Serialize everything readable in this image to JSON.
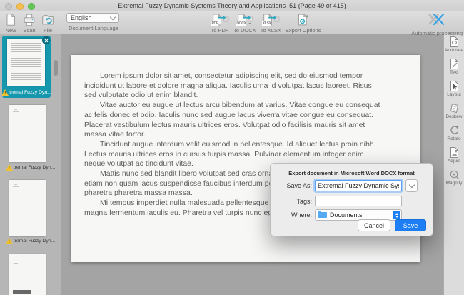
{
  "window": {
    "title": "Extremal Fuzzy Dynamic Systems Theory and Applications_51 (Page 49 of 415)"
  },
  "colors": {
    "accent_teal": "#1598ad",
    "macos_blue": "#1d7ff3",
    "icon_cyan": "#2aa9c0",
    "warning_yellow": "#f2c12e",
    "folder_blue": "#55a9f2"
  },
  "toolbar": {
    "buttons": [
      {
        "label": "New"
      },
      {
        "label": "Scan"
      },
      {
        "label": "File"
      }
    ],
    "language": {
      "value": "English",
      "label": "Document Language"
    },
    "export": [
      {
        "label": "To PDF",
        "badge": "PDF"
      },
      {
        "label": "To DOCX",
        "badge": "DOCX"
      },
      {
        "label": "To XLSX",
        "badge": "XLSX"
      },
      {
        "label": "Export Options"
      }
    ],
    "auto_label": "Automatic processing"
  },
  "sidebar": {
    "thumbnails": [
      {
        "label": "tremal Fuzzy Dyn...",
        "selected": true,
        "warning": true
      },
      {
        "label": "tremal Fuzzy Dyn...",
        "selected": false,
        "warning": true
      },
      {
        "label": "tremal Fuzzy Dyn...",
        "selected": false,
        "warning": true
      },
      {
        "label": "",
        "selected": false,
        "warning": false
      }
    ]
  },
  "document": {
    "paragraphs": [
      {
        "lines": [
          "Lorem ipsum dolor sit amet, consectetur adipiscing elit, sed do eiusmod tempor",
          "incididunt ut labore et dolore magna aliqua. Iaculis urna id volutpat lacus laoreet. Risus",
          "sed vulputate odio ut enim blandit."
        ]
      },
      {
        "lines": [
          "Vitae auctor eu augue ut lectus arcu bibendum at varius. Vitae congue eu consequat",
          "ac felis donec et odio. Iaculis nunc sed augue lacus viverra vitae congue eu consequat.",
          "Placerat vestibulum lectus mauris ultrices eros. Volutpat odio facilisis mauris sit amet",
          "massa vitae tortor."
        ]
      },
      {
        "lines": [
          "Tincidunt augue interdum velit euismod in pellentesque. Id aliquet lectus proin nibh.",
          "Lectus mauris ultrices eros in cursus turpis massa. Pulvinar elementum integer enim",
          "neque volutpat ac tincidunt vitae."
        ]
      },
      {
        "lines": [
          "Mattis nunc sed blandit libero volutpat sed cras ornare arcu dui vivamus",
          "etiam non quam lacus suspendisse faucibus interdum posuere lorem ipsum",
          "pharetra pharetra massa massa."
        ]
      },
      {
        "lines": [
          "Mi tempus imperdiet nulla malesuada pellentesque elit eget gravida cum",
          "magna fermentum iaculis eu. Pharetra vel turpis nunc eget lorem dolor sed."
        ]
      }
    ]
  },
  "tools": [
    {
      "label": "Annotate"
    },
    {
      "label": "Text"
    },
    {
      "label": "Layout"
    },
    {
      "label": "Deskew"
    },
    {
      "label": "Rotate"
    },
    {
      "label": "Adjust"
    },
    {
      "label": "Magnify"
    }
  ],
  "dialog": {
    "title": "Export document in Microsoft Word DOCX format",
    "save_as_label": "Save As:",
    "save_as_value": "Extremal Fuzzy Dynamic Systems Theor",
    "tags_label": "Tags:",
    "tags_value": "",
    "where_label": "Where:",
    "where_value": "Documents",
    "cancel_label": "Cancel",
    "save_label": "Save"
  }
}
